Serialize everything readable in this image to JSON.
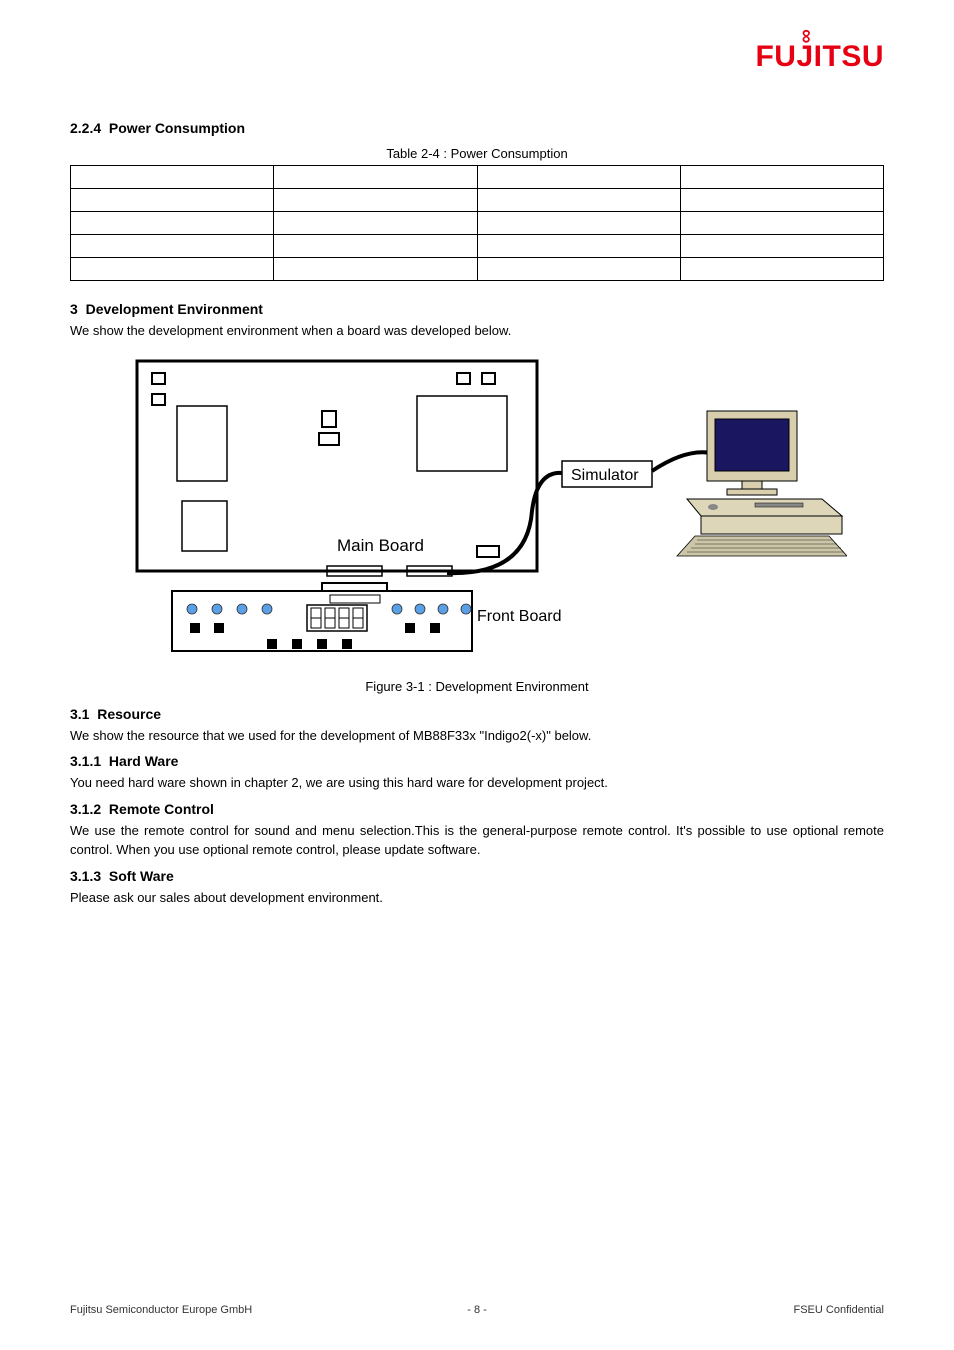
{
  "logo": "FUJITSU",
  "section_num": "2.2.4",
  "section_title": "Power Consumption",
  "table_caption": "Table 2-4 : Power Consumption",
  "table_rows": [
    [
      "",
      "",
      "",
      ""
    ],
    [
      "",
      "",
      "",
      ""
    ],
    [
      "",
      "",
      "",
      ""
    ],
    [
      "",
      "",
      "",
      ""
    ],
    [
      "",
      "",
      "",
      ""
    ]
  ],
  "section3_num": "3",
  "section3_title": "Development Environment",
  "section3_body": "We show the development environment when a board was developed below.",
  "fig_labels": {
    "main_board": "Main Board",
    "simulator": "Simulator",
    "front_board": "Front Board"
  },
  "fig_caption": "Figure 3-1 : Development Environment",
  "section31_num": "3.1",
  "section31_title": "Resource",
  "section31_body": "We show the resource that we used for the development of MB88F33x \"Indigo2(-x)\" below.",
  "section311_num": "3.1.1",
  "section311_title": "Hard Ware",
  "section311_body": "You need hard ware shown in chapter 2, we are using this hard ware for development project.",
  "section312_num": "3.1.2",
  "section312_title": "Remote Control",
  "section312_body": "We use the remote control for sound and menu selection.This is the general-purpose remote control. It's possible to use optional remote control. When you use optional remote control, please update software.",
  "section313_num": "3.1.3",
  "section313_title": "Soft Ware",
  "section313_body": "Please ask our sales about development environment.",
  "footer_left": "Fujitsu Semiconductor Europe GmbH",
  "footer_page": "- 8 -",
  "footer_right": "FSEU Confidential"
}
